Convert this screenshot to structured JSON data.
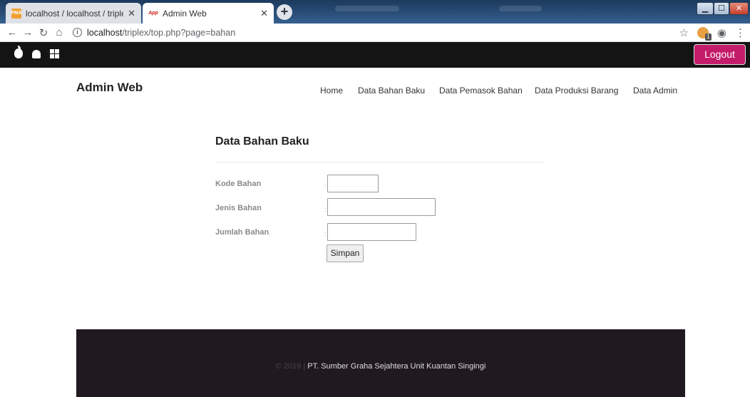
{
  "browser": {
    "tabs": [
      {
        "title": "localhost / localhost / triplex / pr",
        "favicon": "phpmyadmin-icon",
        "active": false
      },
      {
        "title": "Admin Web",
        "favicon": "app-icon",
        "active": true
      }
    ],
    "address": {
      "host": "localhost",
      "path": "/triplex/top.php?page=bahan"
    },
    "icons": [
      "back-icon",
      "forward-icon",
      "reload-icon",
      "home-icon",
      "info-icon",
      "star-icon",
      "extension-icon",
      "profile-icon",
      "menu-icon"
    ]
  },
  "topbar": {
    "os_icons": [
      "apple-icon",
      "android-icon",
      "windows-icon"
    ],
    "logout_label": "Logout"
  },
  "site": {
    "brand": "Admin Web",
    "nav": [
      "Home",
      "Data Bahan Baku",
      "Data Pemasok Bahan",
      "Data Produksi Barang",
      "Data Admin"
    ]
  },
  "form": {
    "title": "Data Bahan Baku",
    "fields": [
      {
        "label": "Kode Bahan",
        "colon": ":",
        "value": ""
      },
      {
        "label": "Jenis Bahan",
        "colon": ":",
        "value": ""
      },
      {
        "label": "Jumlah Bahan",
        "colon": ":",
        "value": ""
      }
    ],
    "submit_label": "Simpan"
  },
  "footer": {
    "copyright": "© 2019 |",
    "company": "PT. Sumber Graha Sejahtera Unit Kuantan Singingi"
  },
  "colors": {
    "topbar": "#141414",
    "logout": "#c41b6a",
    "footer": "#201a20"
  }
}
